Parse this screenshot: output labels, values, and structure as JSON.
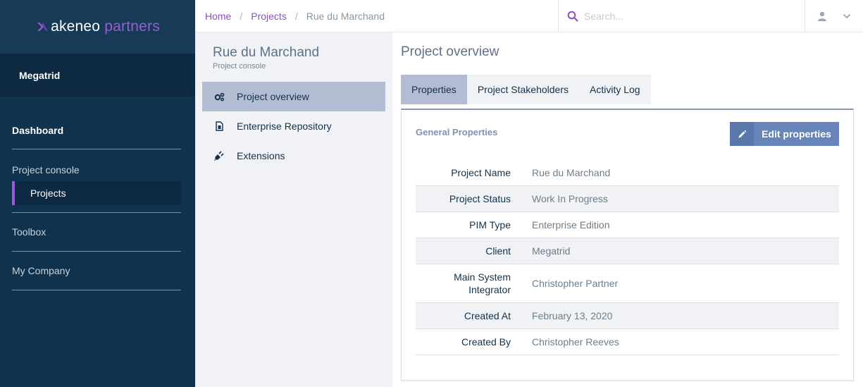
{
  "brand": {
    "name": "akeneo",
    "suffix": "partners"
  },
  "sidebar": {
    "company": "Megatrid",
    "dashboard": "Dashboard",
    "section_label": "Project console",
    "active_item": "Projects",
    "items": [
      "Toolbox",
      "My Company"
    ]
  },
  "breadcrumb": {
    "home": "Home",
    "projects": "Projects",
    "current": "Rue du Marchand",
    "separator": "/"
  },
  "search": {
    "placeholder": "Search..."
  },
  "project": {
    "title": "Rue du Marchand",
    "subtitle": "Project console"
  },
  "subnav": {
    "items": [
      {
        "label": "Project overview",
        "icon": "gears-icon",
        "active": true
      },
      {
        "label": "Enterprise Repository",
        "icon": "file-icon",
        "active": false
      },
      {
        "label": "Extensions",
        "icon": "plug-icon",
        "active": false
      }
    ]
  },
  "main": {
    "title": "Project overview",
    "tabs": [
      "Properties",
      "Project Stakeholders",
      "Activity Log"
    ],
    "active_tab": "Properties",
    "card_title": "General Properties",
    "edit_label": "Edit properties",
    "properties": [
      {
        "label": "Project Name",
        "value": "Rue du Marchand"
      },
      {
        "label": "Project Status",
        "value": "Work In Progress"
      },
      {
        "label": "PIM Type",
        "value": "Enterprise Edition"
      },
      {
        "label": "Client",
        "value": "Megatrid"
      },
      {
        "label": "Main System Integrator",
        "value": "Christopher Partner"
      },
      {
        "label": "Created At",
        "value": "February 13, 2020"
      },
      {
        "label": "Created By",
        "value": "Christopher Reeves"
      }
    ]
  },
  "colors": {
    "sidebar_bg": "#11324d",
    "accent": "#9a5bd6",
    "active_bg": "#b2bdd3",
    "button": "#6785b8"
  }
}
